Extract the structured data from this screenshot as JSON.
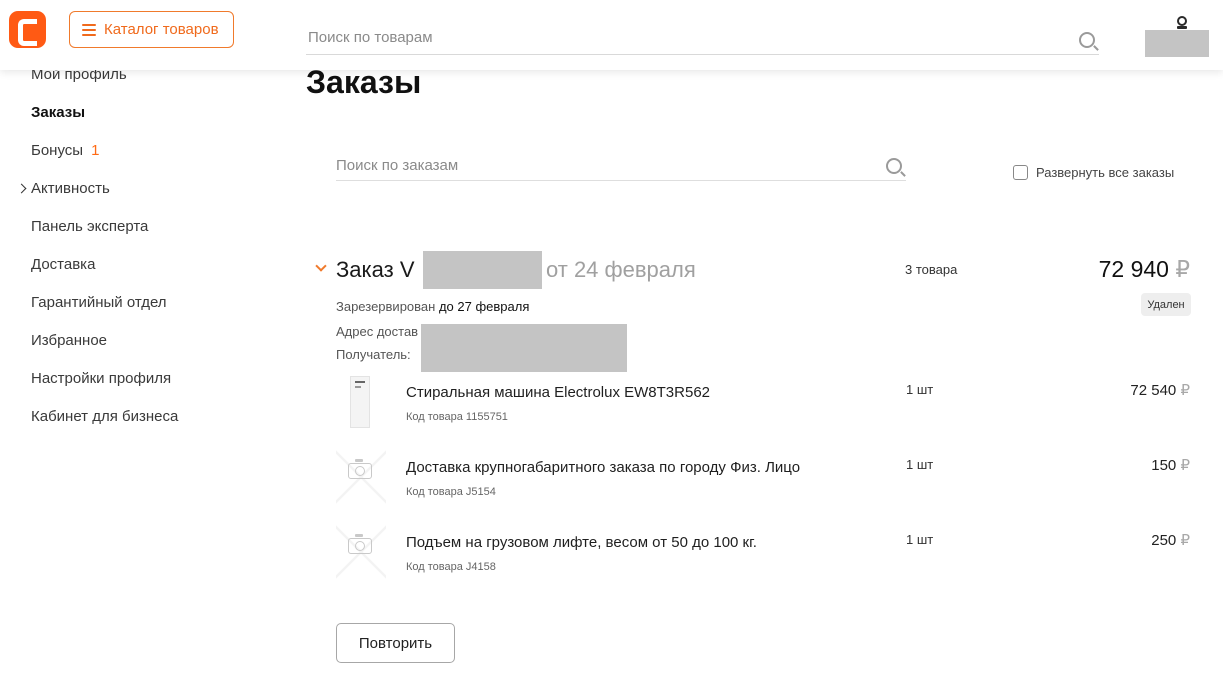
{
  "header": {
    "catalog_button": "Каталог товаров",
    "search_placeholder": "Поиск по товарам",
    "logo_icon": "brand-logo-icon",
    "user_icon": "user-icon",
    "accent_color": "#ff5a14"
  },
  "sidebar": {
    "items": [
      {
        "label": "Мой профиль"
      },
      {
        "label": "Заказы",
        "active": true
      },
      {
        "label": "Бонусы",
        "badge": "1"
      },
      {
        "label": "Активность",
        "expandable": true
      },
      {
        "label": "Панель эксперта"
      },
      {
        "label": "Доставка"
      },
      {
        "label": "Гарантийный отдел"
      },
      {
        "label": "Избранное"
      },
      {
        "label": "Настройки профиля"
      },
      {
        "label": "Кабинет для бизнеса"
      }
    ]
  },
  "main": {
    "title": "Заказы",
    "order_search_placeholder": "Поиск по заказам",
    "expand_all_label": "Развернуть все заказы",
    "order": {
      "title_prefix": "Заказ V",
      "date_text": "от 24 февраля",
      "items_count": "3 товара",
      "total": "72 940",
      "currency": "₽",
      "status": "Удален",
      "reserved_label": "Зарезервирован",
      "reserved_until": "до 27 февраля",
      "address_label": "Адрес достав",
      "recipient_label": "Получатель:",
      "items": [
        {
          "name": "Стиральная машина Electrolux EW8T3R562",
          "code": "Код товара 1155751",
          "qty": "1 шт",
          "price": "72 540",
          "thumb": "washing-machine-image"
        },
        {
          "name": "Доставка крупногабаритного заказа по городу Физ. Лицо",
          "code": "Код товара J5154",
          "qty": "1 шт",
          "price": "150",
          "thumb": "camera-icon"
        },
        {
          "name": "Подъем на грузовом лифте, весом от 50 до 100 кг.",
          "code": "Код товара J4158",
          "qty": "1 шт",
          "price": "250",
          "thumb": "camera-icon"
        }
      ],
      "repeat_button": "Повторить"
    }
  }
}
